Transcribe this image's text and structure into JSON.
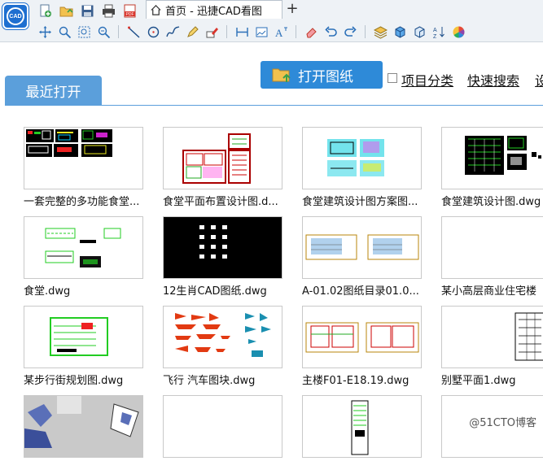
{
  "app": {
    "logo_text": "CAD"
  },
  "tab": {
    "label": "首页 - 迅捷CAD看图"
  },
  "toolbar": {
    "row1": [
      "new-file-icon",
      "open-folder-icon",
      "save-icon",
      "print-icon",
      "pdf-icon"
    ],
    "row2": [
      "pan-icon",
      "zoom-window-icon",
      "zoom-extents-icon",
      "zoom-realtime-icon",
      "line-icon",
      "circle-icon",
      "spline-icon",
      "pencil-icon",
      "mark-icon",
      "measure-icon",
      "image-icon",
      "text-icon",
      "eraser-icon",
      "undo-icon",
      "redo-icon",
      "layers-icon",
      "cube-icon",
      "3d-view-icon",
      "sort-icon",
      "color-wheel-icon"
    ]
  },
  "main": {
    "open_button": "打开图纸",
    "checkbox_label": "项目分类",
    "quick_search": "快速搜索",
    "settings_cut": "设",
    "recent_tab": "最近打开"
  },
  "files": [
    {
      "name": "一套完整的多功能食堂...",
      "thumb": "plan-color"
    },
    {
      "name": "食堂平面布置设计图.d...",
      "thumb": "plan-red"
    },
    {
      "name": "食堂建筑设计图方案图...",
      "thumb": "plan-cyan"
    },
    {
      "name": "食堂建筑设计图.dwg",
      "thumb": "plan-black"
    },
    {
      "name": "食堂.dwg",
      "thumb": "plan-green"
    },
    {
      "name": "12生肖CAD图纸.dwg",
      "thumb": "dark-zodiac"
    },
    {
      "name": "A-01.02图纸目录01.0...",
      "thumb": "elevation"
    },
    {
      "name": "某小高层商业住宅楼",
      "thumb": "blank"
    },
    {
      "name": "某步行街规划图.dwg",
      "thumb": "plan-green-frame"
    },
    {
      "name": "飞行 汽车图块.dwg",
      "thumb": "vehicles"
    },
    {
      "name": "主楼F01-E18.19.dwg",
      "thumb": "sections"
    },
    {
      "name": "别墅平面1.dwg",
      "thumb": "villa"
    },
    {
      "name": "",
      "thumb": "sketch"
    },
    {
      "name": "",
      "thumb": "blank"
    },
    {
      "name": "",
      "thumb": "tall-plan"
    },
    {
      "name": "",
      "thumb": "blank"
    }
  ],
  "watermark": "@51CTO博客",
  "colors": {
    "accent": "#2e8ad8",
    "tab_blue": "#5b9fdb"
  }
}
